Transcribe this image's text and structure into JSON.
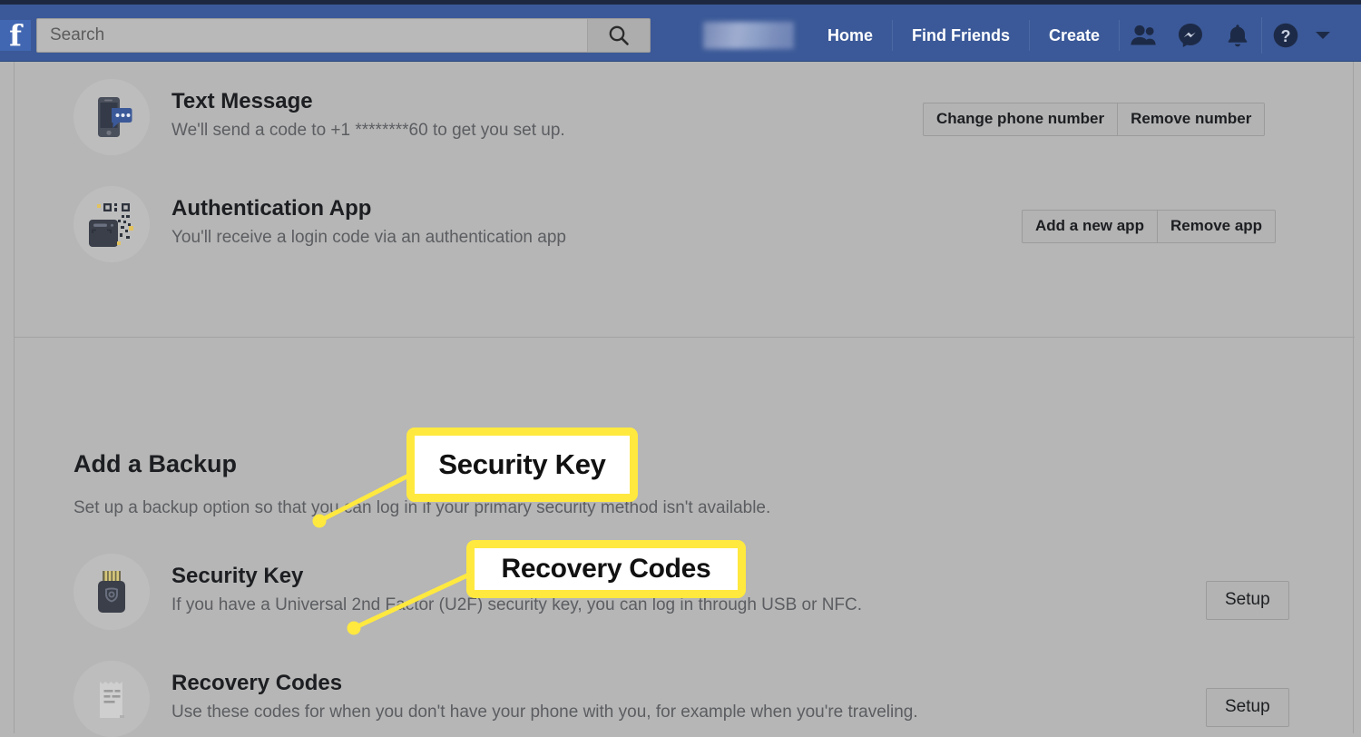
{
  "nav": {
    "logo_text": "f",
    "logo_icon": "facebook-logo-icon",
    "search": {
      "placeholder": "Search",
      "value": "",
      "button_icon": "search-icon"
    },
    "profile_name_blurred": "",
    "links": [
      {
        "label": "Home",
        "name": "home"
      },
      {
        "label": "Find Friends",
        "name": "find-friends"
      },
      {
        "label": "Create",
        "name": "create"
      }
    ],
    "icons": [
      {
        "name": "friend-requests-icon",
        "label": "Friend Requests"
      },
      {
        "name": "messenger-icon",
        "label": "Messenger"
      },
      {
        "name": "notifications-bell-icon",
        "label": "Notifications"
      },
      {
        "name": "help-question-icon",
        "label": "Help"
      },
      {
        "name": "account-chevron-down-icon",
        "label": "Account"
      }
    ]
  },
  "primary_methods": [
    {
      "icon": "phone-text-message-icon",
      "title": "Text Message",
      "description": "We'll send a code to +1 ********60 to get you set up.",
      "buttons": [
        {
          "label": "Change phone number",
          "name": "change-phone-number"
        },
        {
          "label": "Remove number",
          "name": "remove-number"
        }
      ]
    },
    {
      "icon": "authentication-app-qr-icon",
      "title": "Authentication App",
      "description": "You'll receive a login code via an authentication app",
      "buttons": [
        {
          "label": "Add a new app",
          "name": "add-a-new-app"
        },
        {
          "label": "Remove app",
          "name": "remove-app"
        }
      ]
    }
  ],
  "backup": {
    "heading": "Add a Backup",
    "description": "Set up a backup option so that you can log in if your primary security method isn't available.",
    "options": [
      {
        "icon": "usb-security-key-icon",
        "title": "Security Key",
        "description": "If you have a Universal 2nd Factor (U2F) security key, you can log in through USB or NFC.",
        "button": {
          "label": "Setup",
          "name": "setup-security-key"
        }
      },
      {
        "icon": "recovery-codes-paper-icon",
        "title": "Recovery Codes",
        "description": "Use these codes for when you don't have your phone with you, for example when you're traveling.",
        "button": {
          "label": "Setup",
          "name": "setup-recovery-codes"
        }
      }
    ]
  },
  "annotations": [
    {
      "name": "callout-security-key",
      "text": "Security Key"
    },
    {
      "name": "callout-recovery-codes",
      "text": "Recovery Codes"
    }
  ],
  "colors": {
    "facebook_blue": "#3b5998",
    "nav_dark": "#1d2840",
    "page_gray": "#b6b6b6",
    "callout_yellow": "#ffe93f",
    "text_primary": "#1c1e21",
    "text_secondary": "#5b5d61"
  }
}
